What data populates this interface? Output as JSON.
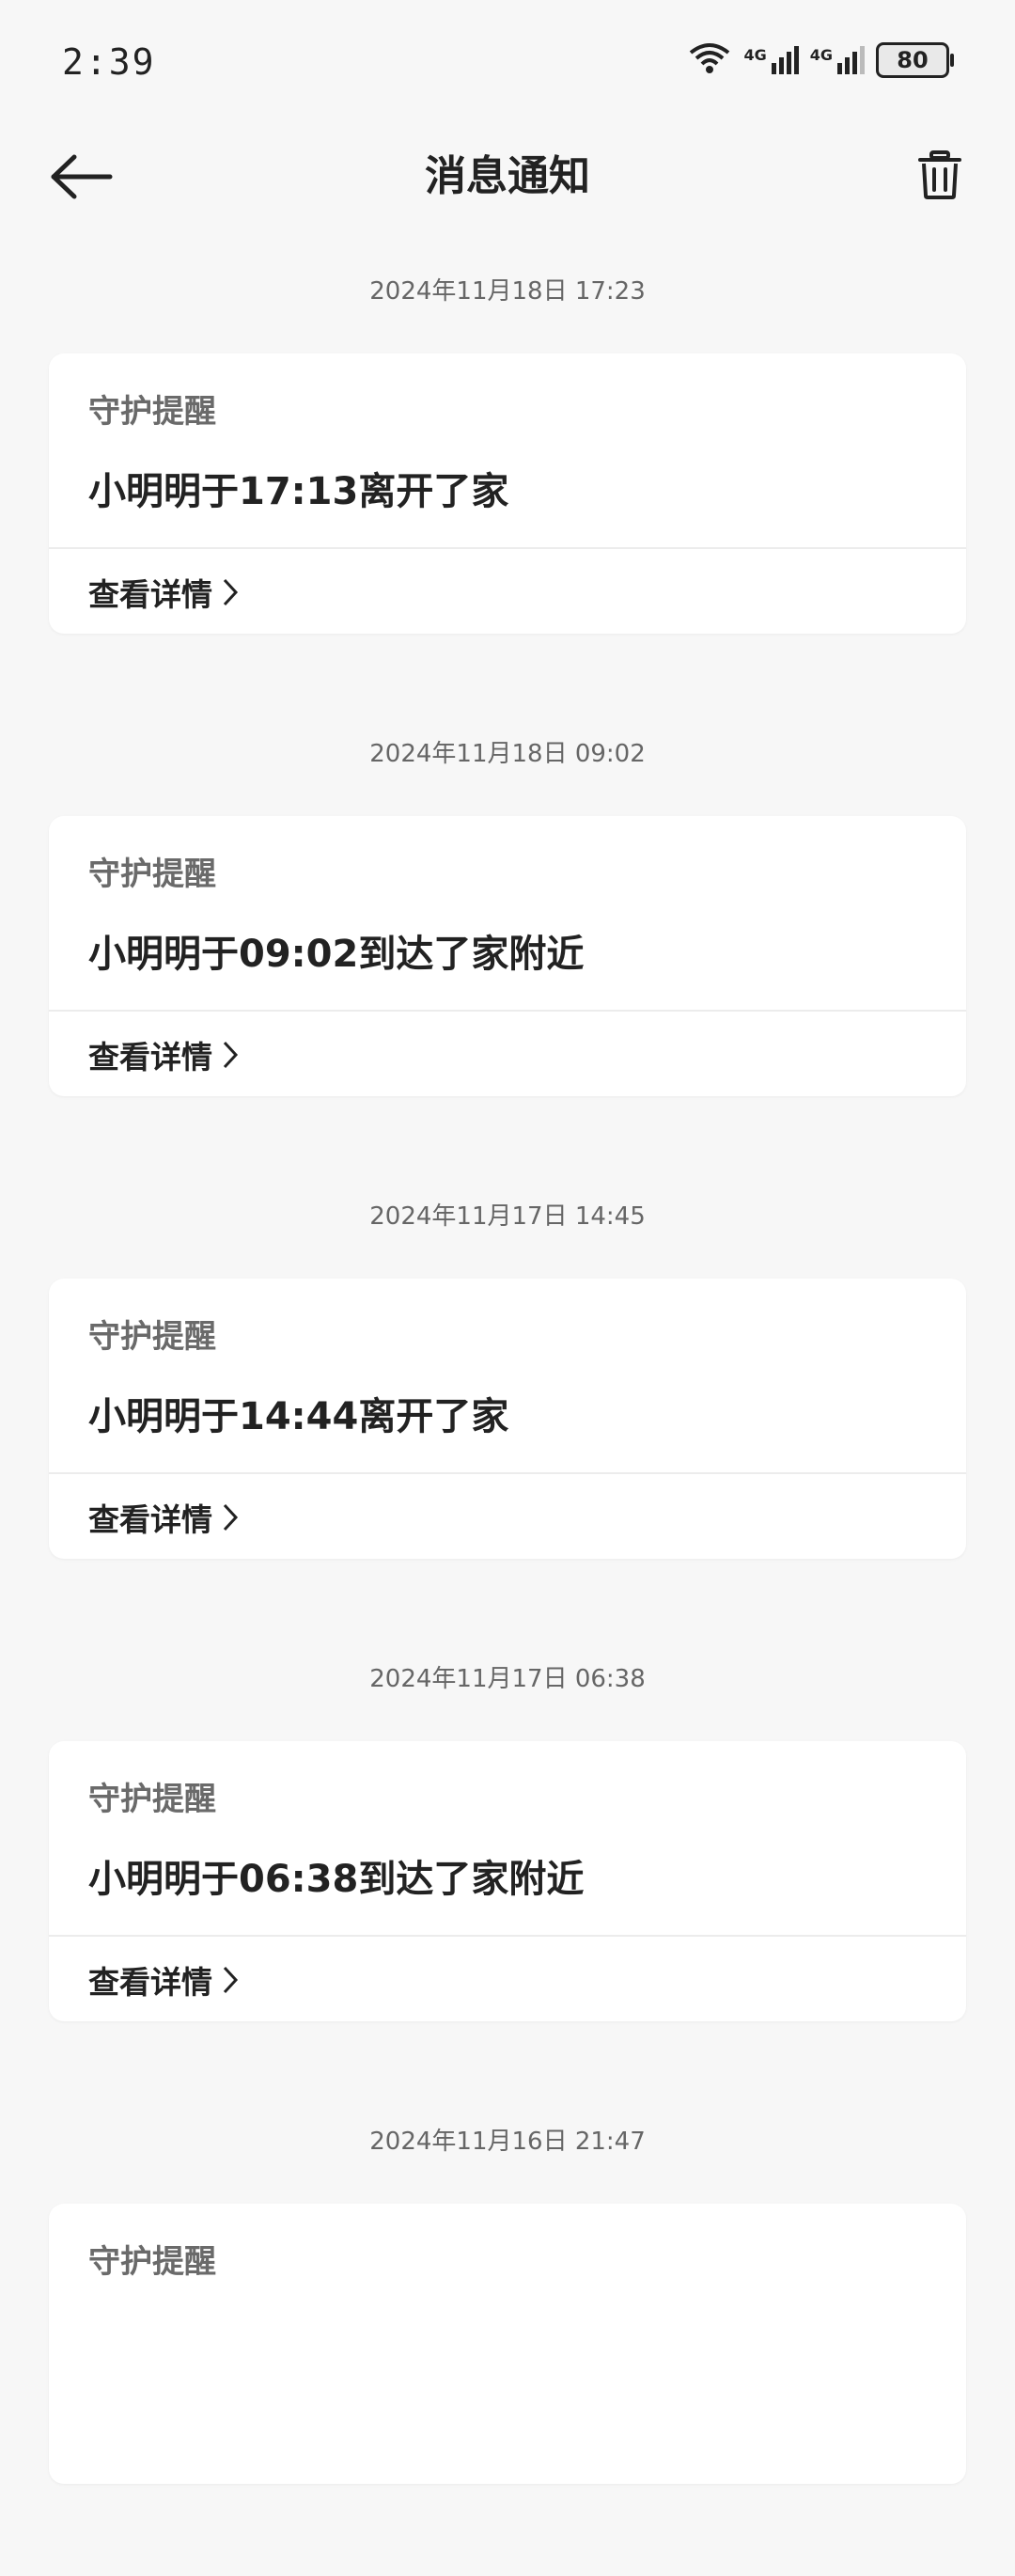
{
  "status_bar": {
    "time": "2:39",
    "signal_1_label": "4G",
    "signal_2_label": "4G",
    "battery": "80",
    "icons": [
      "wifi-icon",
      "signal-icon",
      "signal-icon",
      "battery-icon"
    ]
  },
  "header": {
    "title": "消息通知",
    "back_icon": "arrow-left-icon",
    "delete_icon": "trash-icon"
  },
  "messages": [
    {
      "timestamp": "2024年11月18日 17:23",
      "category": "守护提醒",
      "text": "小明明于17:13离开了家",
      "link": "查看详情"
    },
    {
      "timestamp": "2024年11月18日 09:02",
      "category": "守护提醒",
      "text": "小明明于09:02到达了家附近",
      "link": "查看详情"
    },
    {
      "timestamp": "2024年11月17日 14:45",
      "category": "守护提醒",
      "text": "小明明于14:44离开了家",
      "link": "查看详情"
    },
    {
      "timestamp": "2024年11月17日 06:38",
      "category": "守护提醒",
      "text": "小明明于06:38到达了家附近",
      "link": "查看详情"
    },
    {
      "timestamp": "2024年11月16日 21:47",
      "category": "守护提醒",
      "text": "",
      "link": ""
    }
  ]
}
